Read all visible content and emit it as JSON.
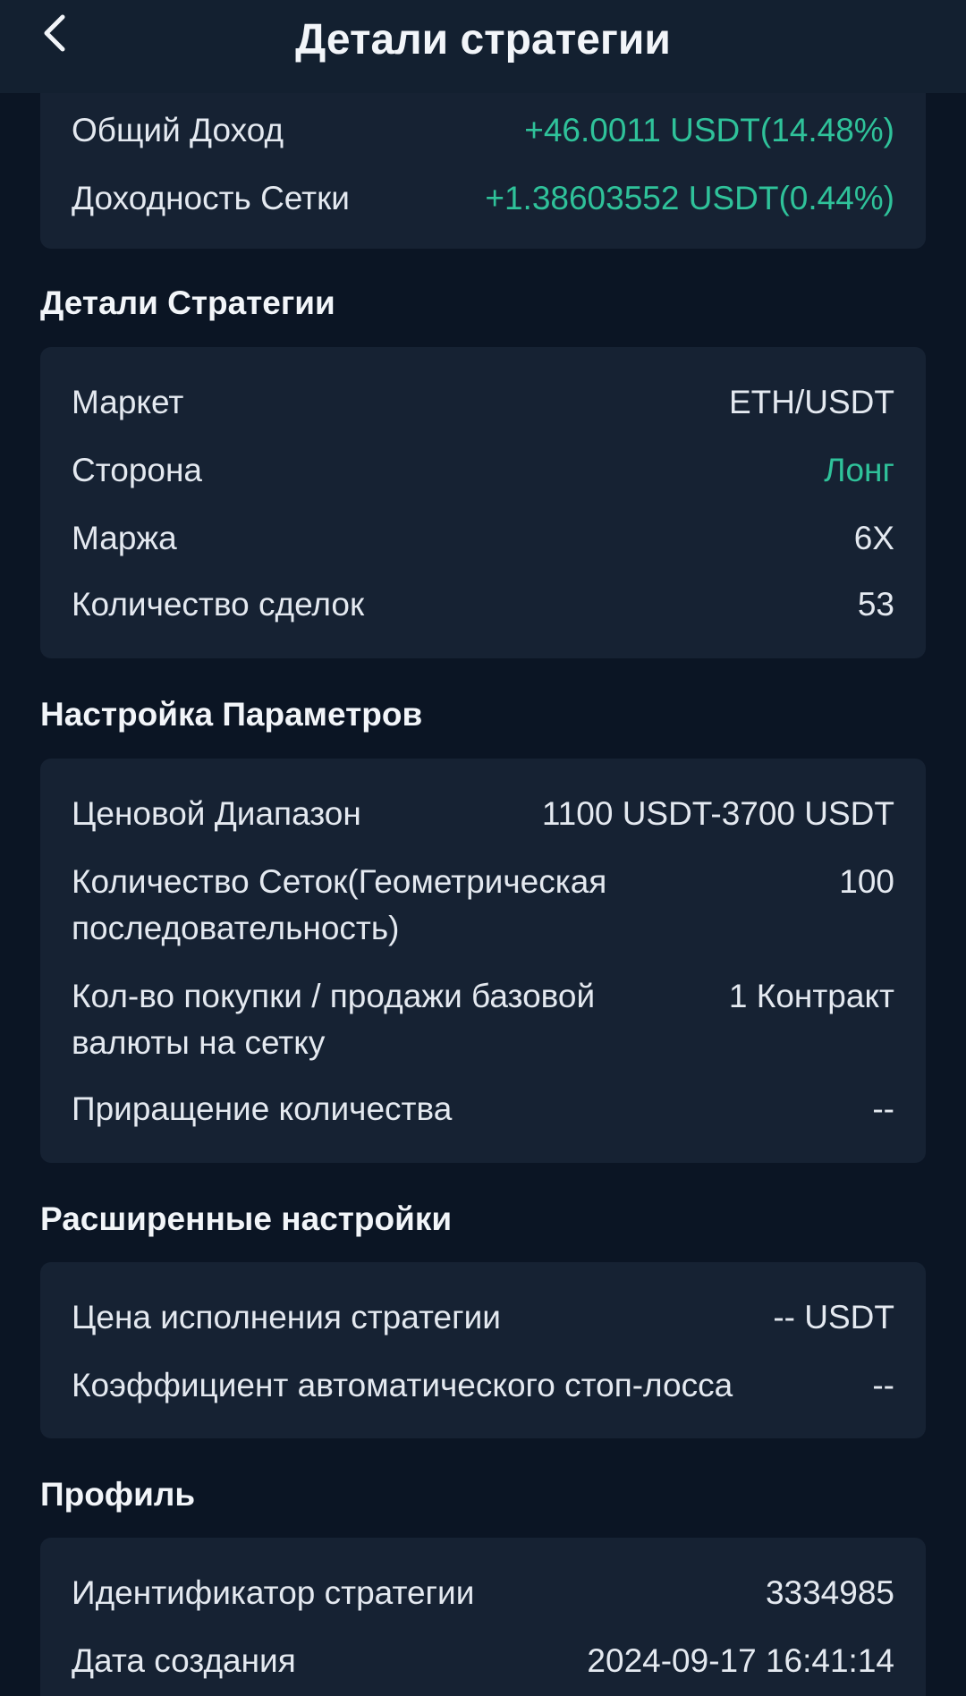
{
  "header": {
    "title": "Детали стратегии",
    "back_icon": "chevron-left-icon"
  },
  "income": {
    "total_label": "Общий Доход",
    "total_value": "+46.0011 USDT(14.48%)",
    "grid_label": "Доходность Сетки",
    "grid_value": "+1.38603552 USDT(0.44%)"
  },
  "strategy_details": {
    "title": "Детали Стратегии",
    "rows": [
      {
        "label": "Маркет",
        "value": "ETH/USDT"
      },
      {
        "label": "Сторона",
        "value": "Лонг"
      },
      {
        "label": "Маржа",
        "value": "6X"
      },
      {
        "label": "Количество сделок",
        "value": "53"
      }
    ]
  },
  "parameters": {
    "title": "Настройка Параметров",
    "rows": [
      {
        "label": "Ценовой Диапазон",
        "value": "1100 USDT-3700 USDT"
      },
      {
        "label": "Количество Сеток(Геометрическая последовательность)",
        "value": "100"
      },
      {
        "label": "Кол-во покупки / продажи базовой валюты на сетку",
        "value": "1 Контракт"
      },
      {
        "label": "Приращение количества",
        "value": "--"
      }
    ]
  },
  "advanced": {
    "title": "Расширенные настройки",
    "rows": [
      {
        "label": "Цена исполнения стратегии",
        "value": "-- USDT"
      },
      {
        "label": "Коэффициент автоматического стоп-лосса",
        "value": "--"
      }
    ]
  },
  "profile": {
    "title": "Профиль",
    "rows": [
      {
        "label": "Идентификатор стратегии",
        "value": "3334985"
      },
      {
        "label": "Дата создания",
        "value": "2024-09-17 16:41:14"
      }
    ]
  },
  "colors": {
    "background": "#0b1524",
    "card": "#162233",
    "header": "#132030",
    "accent_green": "#2fc29a"
  }
}
